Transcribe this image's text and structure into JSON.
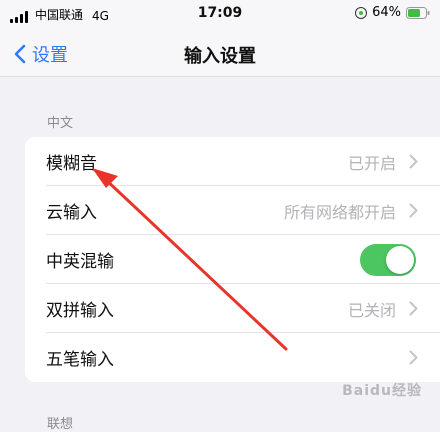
{
  "status": {
    "carrier": "中国联通",
    "network": "4G",
    "time": "17:09",
    "battery": "64%"
  },
  "nav": {
    "back_label": "设置",
    "title": "输入设置"
  },
  "section_chinese": {
    "header": "中文",
    "rows": [
      {
        "label": "模糊音",
        "value": "已开启"
      },
      {
        "label": "云输入",
        "value": "所有网络都开启"
      },
      {
        "label": "中英混输",
        "toggle_on": true
      },
      {
        "label": "双拼输入",
        "value": "已关闭"
      },
      {
        "label": "五笔输入",
        "value": ""
      }
    ]
  },
  "section_next": {
    "header": "联想"
  },
  "watermark": "Baidu经验",
  "colors": {
    "accent": "#2f7bf6",
    "toggle_on": "#4cc660",
    "annotation_arrow": "#e8342a"
  }
}
